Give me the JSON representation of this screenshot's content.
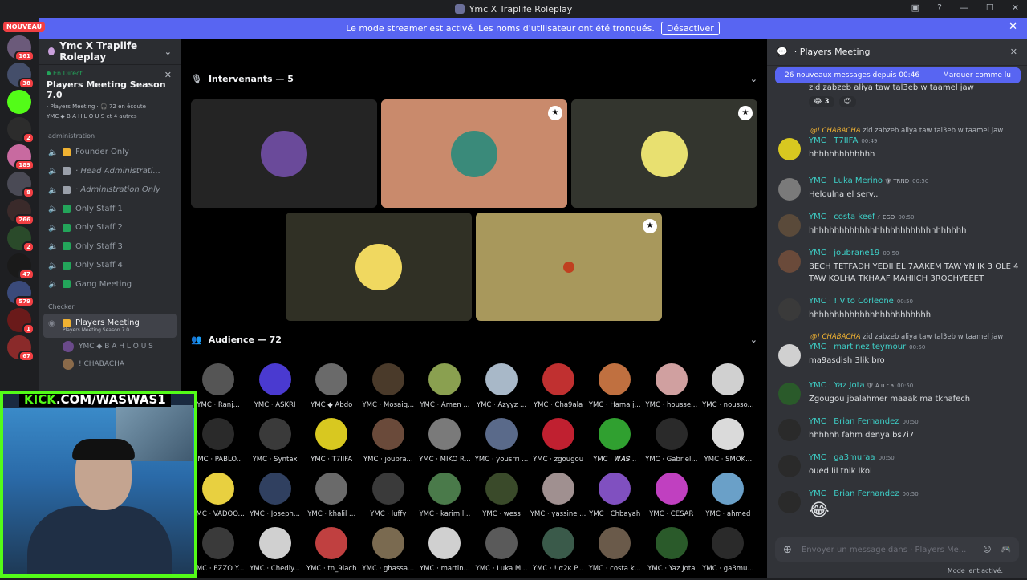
{
  "window": {
    "title": "Ymc X Traplife Roleplay"
  },
  "badge_new": "NOUVEAU",
  "servers": [
    {
      "badge": "161",
      "color": "#6b5a7a"
    },
    {
      "badge": "38",
      "color": "#444e6a"
    },
    {
      "badge": "",
      "color": "#53fc18"
    },
    {
      "badge": "2",
      "color": "#2c2c2c"
    },
    {
      "badge": "189",
      "color": "#c86aa0"
    },
    {
      "badge": "8",
      "color": "#4a4a55"
    },
    {
      "badge": "266",
      "color": "#3a2a2a"
    },
    {
      "badge": "2",
      "color": "#2a4a2a"
    },
    {
      "badge": "47",
      "color": "#1a1a1a"
    },
    {
      "badge": "579",
      "color": "#3a4a7a"
    },
    {
      "badge": "1",
      "color": "#6a1a1a"
    },
    {
      "badge": "67",
      "color": "#8a2a2a"
    }
  ],
  "banner": {
    "text": "Le mode streamer est activé. Les noms d'utilisateur ont été tronqués.",
    "button": "Désactiver"
  },
  "guild": {
    "name": "Ymc X Traplife Roleplay"
  },
  "live": {
    "status": "En Direct",
    "title": "Players Meeting Season 7.0",
    "meta1": "· Players Meeting · 🎧 72 en écoute",
    "meta2": "YMC ◆ B A H L O U S et 4 autres"
  },
  "category_admin": "administration",
  "channels": [
    {
      "label": "Founder Only",
      "emo": "#f0b232"
    },
    {
      "label": "· Head Administrati...",
      "emo": "#9aa0aa"
    },
    {
      "label": "· Administration Only",
      "emo": "#9aa0aa"
    },
    {
      "label": "Only Staff 1",
      "emo": "#23a55a"
    },
    {
      "label": "Only Staff 2",
      "emo": "#23a55a"
    },
    {
      "label": "Only Staff 3",
      "emo": "#23a55a"
    },
    {
      "label": "Only Staff 4",
      "emo": "#23a55a"
    },
    {
      "label": "Gang Meeting",
      "emo": "#23a55a"
    }
  ],
  "category_checker": "Checker",
  "active_channel": {
    "label": "Players Meeting",
    "sub": "Players Meeting Season 7.0"
  },
  "channel_members": [
    {
      "name": "YMC ◆ B A H L O U S",
      "color": "#6a4a8a"
    },
    {
      "name": "! CHABACHA",
      "color": "#8a6a4a"
    }
  ],
  "kick": {
    "prefix": "KICK",
    "url": ".COM/WASWAS1"
  },
  "stage": {
    "speakers_label": "Intervenants — 5",
    "audience_label": "Audience — 72"
  },
  "speakers": [
    {
      "bg": "#242424",
      "av": "#6a4a9a"
    },
    {
      "bg": "#c98a6c",
      "av": "#3a8a7a"
    },
    {
      "bg": "#33352e",
      "av": "#e8e070"
    },
    {
      "bg": "#303025",
      "av": "#f0d860"
    },
    {
      "bg": "#a8985c",
      "av": "#a8985c"
    }
  ],
  "audience": [
    "YMC · Ranj...",
    "YMC · ASKRI",
    "YMC ◆ Abdo",
    "YMC · Mosaiq...",
    "YMC · Amen ...",
    "YMC · Azyyz ...",
    "YMC · Cha9ala",
    "YMC · Hama j...",
    "YMC · housse...",
    "YMC · nousso...",
    "YMC · PABLO...",
    "YMC · Syntax",
    "YMC · T7IIFA",
    "YMC · joubra...",
    "YMC · MIKO R...",
    "YMC · yousrri ...",
    "YMC · zgougou",
    "YMC · 𝑾𝑨𝑺...",
    "YMC · Gabriel...",
    "YMC · SMOK...",
    "YMC · VADOO...",
    "YMC · Joseph...",
    "YMC · khalil ...",
    "YMC · luffy",
    "YMC · karim l...",
    "YMC · wess",
    "YMC · yassine ...",
    "YMC · Chbayah",
    "YMC · CESAR",
    "YMC · ahmed",
    "YMC · EZZO Y...",
    "YMC · Chedly...",
    "YMC · tn_9lach",
    "YMC · ghassa...",
    "YMC · martin...",
    "YMC · Luka M...",
    "YMC · ! α2к P...",
    "YMC · costa k...",
    "YMC · Yaz Jota",
    "YMC · ga3mu..."
  ],
  "audience_colors": [
    "#555",
    "#4a3ad0",
    "#6a6a6a",
    "#4a3a2a",
    "#8aa050",
    "#a8b8c8",
    "#c03030",
    "#c07040",
    "#d0a0a0",
    "#d0d0d0",
    "#2a2a2a",
    "#3a3a3a",
    "#d8c820",
    "#6a4a3a",
    "#7a7a7a",
    "#5a6a8a",
    "#c02030",
    "#30a030",
    "#2a2a2a",
    "#dadada",
    "#e8d040",
    "#304060",
    "#6a6a6a",
    "#3a3a3a",
    "#4a7a4a",
    "#3a4a2a",
    "#a09090",
    "#8050c0",
    "#c040c0",
    "#6aa0c8",
    "#3a3a3a",
    "#d0d0d0",
    "#c04040",
    "#7a6a50",
    "#d0d0d0",
    "#5a5a5a",
    "#3a5a4a",
    "#6a5a4a",
    "#2a5a2a",
    "#2a2a2a"
  ],
  "chat": {
    "channel": "· Players Meeting",
    "new_messages": "26 nouveaux messages depuis 00:46",
    "mark_read": "Marquer comme lu",
    "top_text": "zid zabzeb aliya taw tal3eb w taamel jaw",
    "reaction_count": "3",
    "composer_placeholder": "Envoyer un message dans · Players Me...",
    "slow_mode": "Mode lent activé."
  },
  "messages": [
    {
      "reply_user": "@! CHABACHA",
      "reply_text": " zid zabzeb aliya taw tal3eb w taamel jaw",
      "prefix": "YMC · ",
      "author": "T7IIFA",
      "tag": "",
      "time": "00:49",
      "text": "hhhhhhhhhhhhh",
      "av": "#d8c820"
    },
    {
      "reply_user": "",
      "reply_text": "",
      "prefix": "YMC · ",
      "author": "Luka Merino",
      "tag": " 🛡 TRND",
      "time": "00:50",
      "text": "Heloulna el serv..",
      "av": "#7a7a7a"
    },
    {
      "reply_user": "",
      "reply_text": "",
      "prefix": "YMC · ",
      "author": "costa keef",
      "tag": " ⚡ EGO",
      "time": "00:50",
      "text": "hhhhhhhhhhhhhhhhhhhhhhhhhhhhhhh",
      "av": "#5a4a3a"
    },
    {
      "reply_user": "",
      "reply_text": "",
      "prefix": "YMC · ",
      "author": "joubrane19",
      "tag": "",
      "time": "00:50",
      "text": "BECH TETFADH YEDII EL 7AAKEM TAW YNIIK 3 OLE 4 TAW KOLHA TKHAAF MAHIICH 3ROCHYEEET",
      "av": "#6a4a3a"
    },
    {
      "reply_user": "",
      "reply_text": "",
      "prefix": "YMC · ",
      "author": "! Vito Corleone",
      "tag": "",
      "time": "00:50",
      "text": "hhhhhhhhhhhhhhhhhhhhhhhh",
      "av": "#3a3a3a"
    },
    {
      "reply_user": "@! CHABACHA",
      "reply_text": " zid zabzeb aliya taw tal3eb w taamel jaw",
      "prefix": "YMC · ",
      "author": "martinez teymour",
      "tag": "",
      "time": "00:50",
      "text": "ma9asdish 3lik bro",
      "av": "#d0d0d0"
    },
    {
      "reply_user": "",
      "reply_text": "",
      "prefix": "YMC · ",
      "author": "Yaz Jota",
      "tag": " 🛡 A u r a",
      "time": "00:50",
      "text": "Zgougou jbalahmer maaak ma tkhafech",
      "av": "#2a5a2a"
    },
    {
      "reply_user": "",
      "reply_text": "",
      "prefix": "YMC · ",
      "author": "Brian Fernandez",
      "tag": "",
      "time": "00:50",
      "text": "hhhhhh fahm denya bs7i7",
      "av": "#2a2a2a"
    },
    {
      "reply_user": "",
      "reply_text": "",
      "prefix": "YMC · ",
      "author": "ga3muraa",
      "tag": "",
      "time": "00:50",
      "text": "oued lil tnik lkol",
      "av": "#2a2a2a"
    },
    {
      "reply_user": "",
      "reply_text": "",
      "prefix": "YMC · ",
      "author": "Brian Fernandez",
      "tag": "",
      "time": "00:50",
      "text": "😂",
      "av": "#2a2a2a"
    }
  ]
}
